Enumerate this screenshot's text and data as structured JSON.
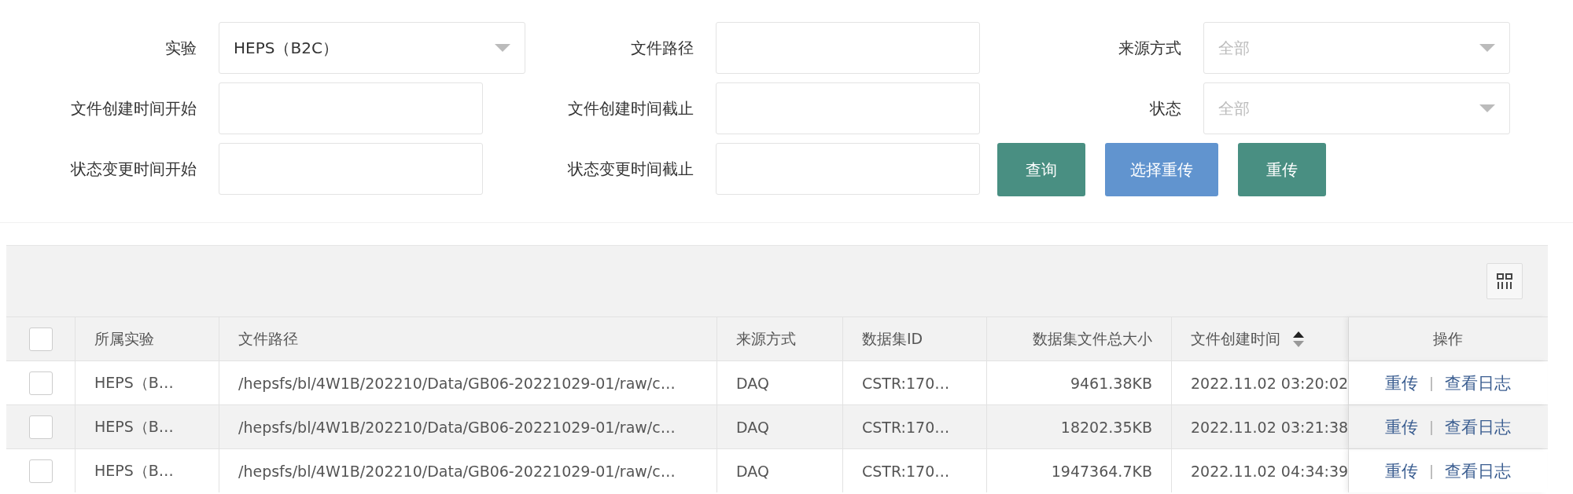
{
  "filters": [
    {
      "label": "实验",
      "kind": "select",
      "value": "HEPS（B2C）"
    },
    {
      "label": "文件路径",
      "kind": "input"
    },
    {
      "label": "来源方式",
      "kind": "select",
      "placeholder": "全部"
    },
    {
      "label": "文件创建时间开始",
      "kind": "input"
    },
    {
      "label": "文件创建时间截止",
      "kind": "input"
    },
    {
      "label": "状态",
      "kind": "select",
      "placeholder": "全部"
    },
    {
      "label": "状态变更时间开始",
      "kind": "input"
    },
    {
      "label": "状态变更时间截止",
      "kind": "input"
    }
  ],
  "buttons": [
    {
      "label": "查询",
      "kind": "primary"
    },
    {
      "label": "选择重传",
      "kind": "info"
    },
    {
      "label": "重传",
      "kind": "primary"
    }
  ],
  "table": {
    "all_checked": false,
    "columns": [
      {
        "label": "所属实验",
        "sortable": false
      },
      {
        "label": "文件路径",
        "sortable": false
      },
      {
        "label": "来源方式",
        "sortable": false
      },
      {
        "label": "数据集ID",
        "sortable": false
      },
      {
        "label": "数据集文件总大小",
        "sortable": false
      },
      {
        "label": "文件创建时间",
        "sortable": true
      }
    ],
    "actions_label": "操作",
    "rows": [
      {
        "checked": false,
        "cells": [
          "HEPS（B…",
          "/hepsfs/bl/4W1B/202210/Data/GB06-20221029-01/raw/c…",
          "DAQ",
          "CSTR:170…",
          "9461.38KB",
          "2022.11.02 03:20:02"
        ],
        "actions": [
          "重传",
          "查看日志"
        ],
        "separator": "|"
      },
      {
        "checked": false,
        "cells": [
          "HEPS（B…",
          "/hepsfs/bl/4W1B/202210/Data/GB06-20221029-01/raw/c…",
          "DAQ",
          "CSTR:170…",
          "18202.35KB",
          "2022.11.02 03:21:38"
        ],
        "actions": [
          "重传",
          "查看日志"
        ],
        "separator": "|"
      },
      {
        "checked": false,
        "cells": [
          "HEPS（B…",
          "/hepsfs/bl/4W1B/202210/Data/GB06-20221029-01/raw/c…",
          "DAQ",
          "CSTR:170…",
          "1947364.7KB",
          "2022.11.02 04:34:39"
        ],
        "actions": [
          "重传",
          "查看日志"
        ],
        "separator": "|"
      }
    ]
  }
}
